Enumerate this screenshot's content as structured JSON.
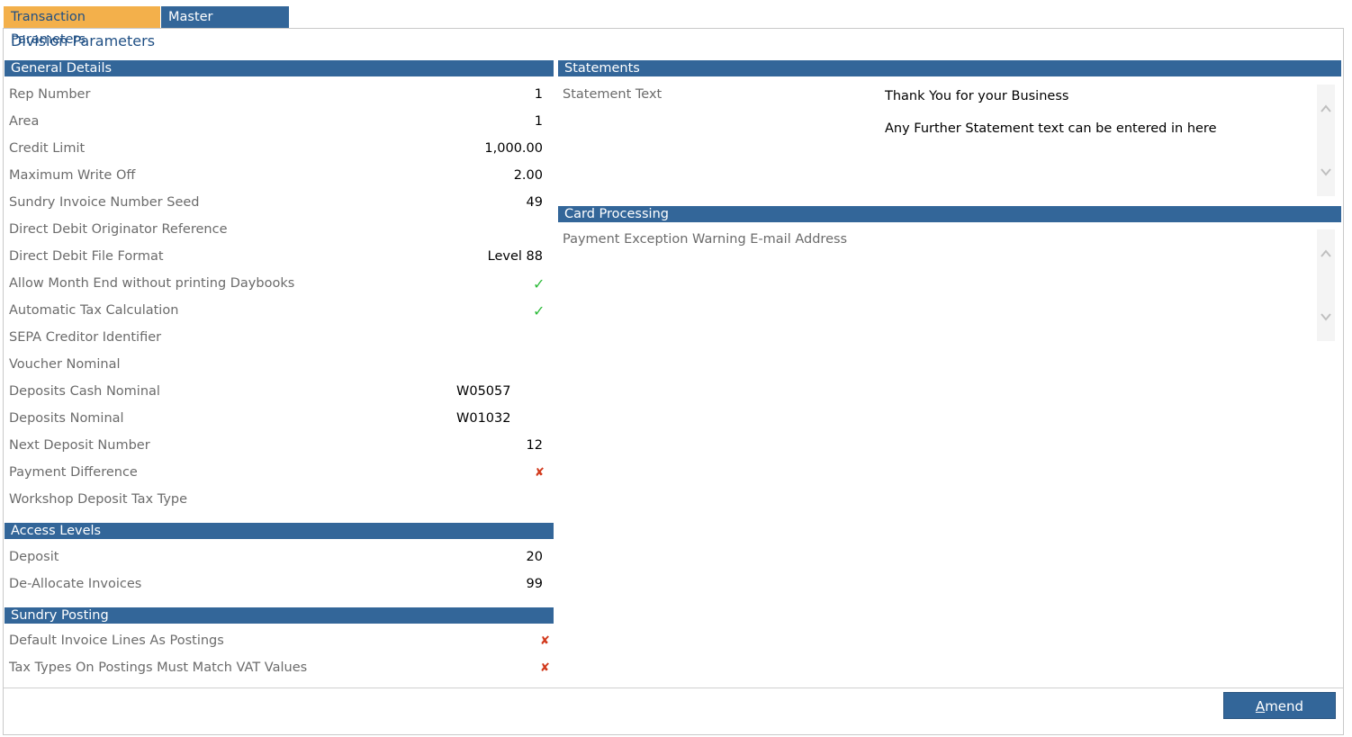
{
  "tabs": [
    {
      "label": "Transaction Parameters"
    },
    {
      "label": "Master Parameters"
    }
  ],
  "title": "Division Parameters",
  "general": {
    "header": "General Details",
    "rows": [
      {
        "label": "Rep Number",
        "value": "1"
      },
      {
        "label": "Area",
        "value": "1"
      },
      {
        "label": "Credit Limit",
        "value": "1,000.00"
      },
      {
        "label": "Maximum Write Off",
        "value": "2.00"
      },
      {
        "label": "Sundry Invoice Number Seed",
        "value": "49"
      },
      {
        "label": "Direct Debit Originator Reference",
        "value": ""
      },
      {
        "label": "Direct Debit File Format",
        "value": "Level 88"
      },
      {
        "label": "Allow Month End without printing Daybooks",
        "value": "✓"
      },
      {
        "label": "Automatic Tax Calculation",
        "value": "✓"
      },
      {
        "label": "SEPA Creditor Identifier",
        "value": ""
      },
      {
        "label": "Voucher Nominal",
        "value": ""
      },
      {
        "label": "Deposits Cash Nominal",
        "value": "W05057"
      },
      {
        "label": "Deposits Nominal",
        "value": "W01032"
      },
      {
        "label": "Next Deposit Number",
        "value": "12"
      },
      {
        "label": "Payment Difference",
        "value": "✘"
      },
      {
        "label": "Workshop Deposit Tax Type",
        "value": ""
      }
    ]
  },
  "access": {
    "header": "Access Levels",
    "rows": [
      {
        "label": "Deposit",
        "value": "20"
      },
      {
        "label": "De-Allocate Invoices",
        "value": "99"
      }
    ]
  },
  "sundry": {
    "header": "Sundry Posting",
    "rows": [
      {
        "label": "Default Invoice Lines As Postings",
        "value": "✘"
      },
      {
        "label": "Tax Types On Postings Must Match VAT Values",
        "value": "✘"
      }
    ]
  },
  "statements": {
    "header": "Statements",
    "label": "Statement Text",
    "line1": "Thank You for your Business",
    "line2": "Any Further Statement text can be entered in here"
  },
  "card": {
    "header": "Card Processing",
    "label": "Payment Exception Warning E-mail Address"
  },
  "actions": {
    "amend_accesskey": "A",
    "amend_rest": "mend"
  },
  "colors": {
    "header_bg": "#336699",
    "active_tab": "#f3b04b",
    "tick": "#2dbb3a",
    "cross": "#d23a1d"
  }
}
